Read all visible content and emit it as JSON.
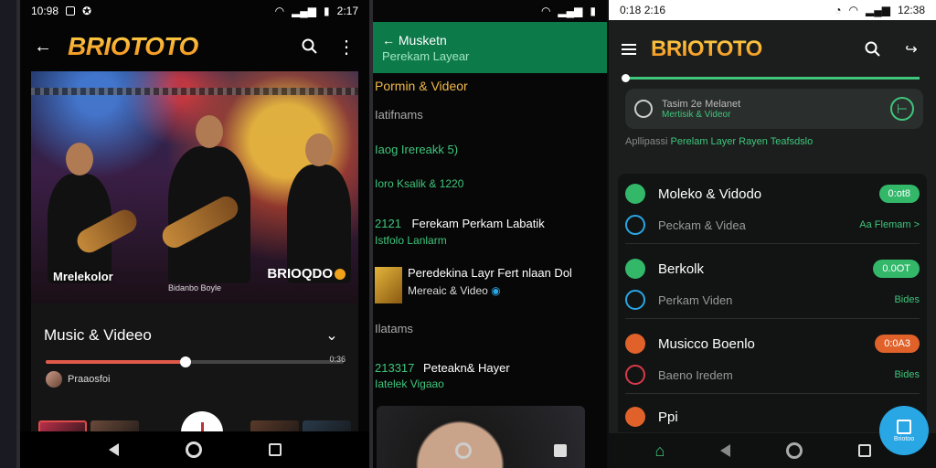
{
  "phone1": {
    "status_time": "10:98",
    "status_right": "2:17",
    "logo": "BRIOTOTO",
    "hero": {
      "caption_left": "Mrelekolor",
      "caption_mid": "Bidanbo Boyle",
      "caption_right": "BRIOQDO"
    },
    "panel": {
      "title": "Music & Videeo",
      "progress": 0.47,
      "end_label": "0:36",
      "user": "Praaosfoi"
    },
    "thumb_colors": [
      "#b8304a",
      "#6a4a3a",
      "#5a3a2a",
      "#2a3a4a"
    ]
  },
  "phone2": {
    "header_title": "Musketn",
    "header_subtitle": "Perekam Layear",
    "section1": "Pormin & Videor",
    "section1_sub": "Iatifnams",
    "item1": "Iaog Irereakk 5)",
    "item2": "Ioro Ksalik & 1220",
    "item3_prefix": "2121",
    "item3_title": "Ferekam Perkam Labatik",
    "item3_sub": "Istfolo Lanlarm",
    "item4_title": "Peredekina Layr Fert nlaan Dol",
    "item4_sub": "Mereaic & Video",
    "item5": "Ilatams",
    "item6_prefix": "213317",
    "item6_title": "Peteakn& Hayer",
    "item6_sub": "Iatelek Vigaao"
  },
  "phone3": {
    "status_left": "0:18 2:16",
    "status_right": "12:38",
    "logo": "BRIOTOTO",
    "card_title": "Tasim 2e Melanet",
    "card_sub": "Mertisik & Videor",
    "desc_prefix": "Apllipassi ",
    "desc_rest": "Perelam Layer Rayen Teafsdslo",
    "rows": [
      {
        "label": "Moleko & Vidodo",
        "pill": "0:ot8",
        "color": "#33b86a",
        "icon": "image-icon"
      },
      {
        "label": "Peckam & Videa",
        "right": "Aa Flemam >",
        "color": "#29a6e4",
        "icon": "check-icon",
        "sub": true
      },
      {
        "label": "Berkolk",
        "pill": "0.0OT",
        "color": "#33b86a",
        "icon": "music-icon"
      },
      {
        "label": "Perkam Viden",
        "right": "Bides",
        "color": "#29a6e4",
        "icon": "send-icon",
        "sub": true
      },
      {
        "label": "Musicco Boenlo",
        "pill": "0:0A3",
        "color": "#e0622a",
        "icon": "video-icon"
      },
      {
        "label": "Baeno Iredem",
        "right": "Bides",
        "color": "#d83a4a",
        "icon": "record-icon",
        "sub": true
      },
      {
        "label": "Ppi",
        "color": "#e0622a",
        "icon": "play-icon"
      }
    ],
    "fab_label": "Briotoo"
  }
}
